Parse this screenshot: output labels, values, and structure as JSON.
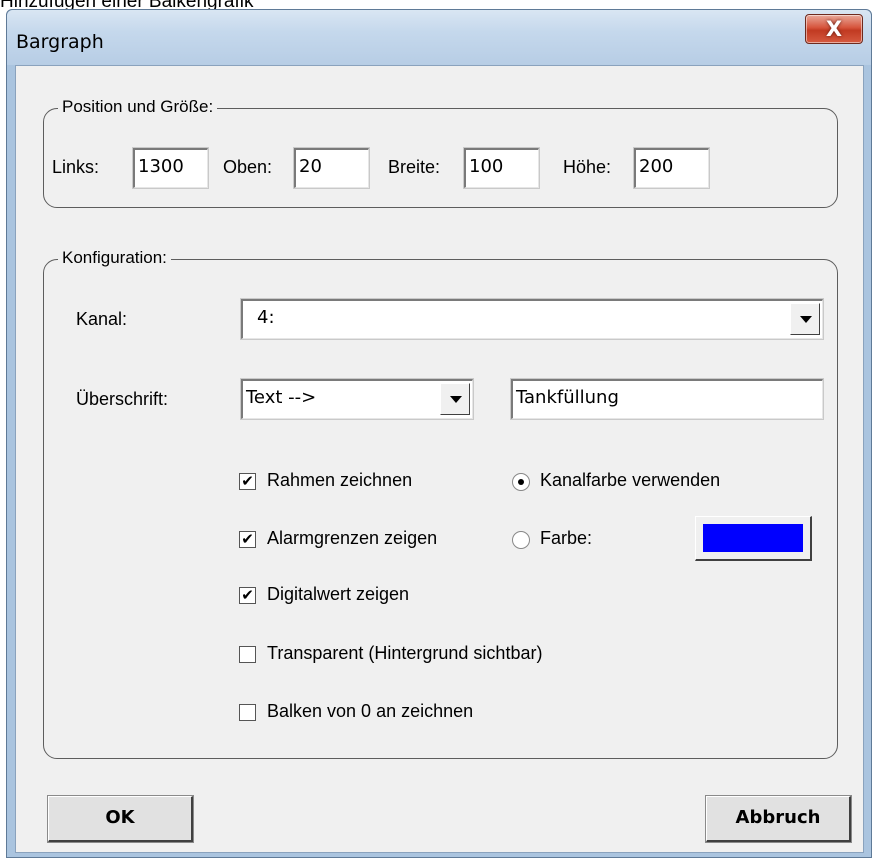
{
  "page_caption": "Hinzufügen einer Balkengrafik",
  "window": {
    "title": "Bargraph",
    "close_label": "X"
  },
  "position_group": {
    "label": "Position und Größe:",
    "links_label": "Links:",
    "links_value": "1300",
    "oben_label": "Oben:",
    "oben_value": "20",
    "breite_label": "Breite:",
    "breite_value": "100",
    "hoehe_label": "Höhe:",
    "hoehe_value": "200"
  },
  "config_group": {
    "label": "Konfiguration:",
    "kanal_label": "Kanal:",
    "kanal_value": "4:",
    "ueberschrift_label": "Überschrift:",
    "ueberschrift_mode": "Text -->",
    "ueberschrift_text": "Tankfüllung",
    "checkboxes": [
      {
        "label": "Rahmen zeichnen",
        "checked": true,
        "mark": "✔"
      },
      {
        "label": "Alarmgrenzen zeigen",
        "checked": true,
        "mark": "✔"
      },
      {
        "label": "Digitalwert zeigen",
        "checked": true,
        "mark": "✔"
      },
      {
        "label": "Transparent (Hintergrund sichtbar)",
        "checked": false,
        "mark": ""
      },
      {
        "label": "Balken von 0 an zeichnen",
        "checked": false,
        "mark": ""
      }
    ],
    "radios": [
      {
        "label": "Kanalfarbe verwenden",
        "selected": true
      },
      {
        "label": "Farbe:",
        "selected": false
      }
    ],
    "color_swatch": "#0000ff"
  },
  "buttons": {
    "ok": "OK",
    "cancel": "Abbruch"
  }
}
